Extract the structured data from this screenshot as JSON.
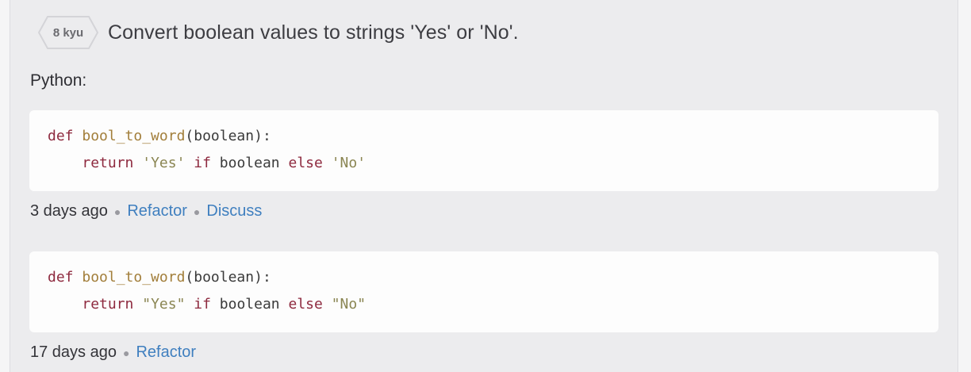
{
  "kata": {
    "rank": "8 kyu",
    "title": "Convert boolean values to strings 'Yes' or 'No'."
  },
  "language_label": "Python:",
  "solutions": [
    {
      "code": [
        {
          "tokens": [
            [
              "kw",
              "def"
            ],
            [
              "plain",
              " "
            ],
            [
              "fn",
              "bool_to_word"
            ],
            [
              "plain",
              "(boolean):"
            ]
          ]
        },
        {
          "tokens": [
            [
              "plain",
              "    "
            ],
            [
              "kw",
              "return"
            ],
            [
              "plain",
              " "
            ],
            [
              "str",
              "'Yes'"
            ],
            [
              "plain",
              " "
            ],
            [
              "kw",
              "if"
            ],
            [
              "plain",
              " boolean "
            ],
            [
              "kw",
              "else"
            ],
            [
              "plain",
              " "
            ],
            [
              "str",
              "'No'"
            ]
          ]
        }
      ],
      "age": "3 days ago",
      "actions": [
        "Refactor",
        "Discuss"
      ]
    },
    {
      "code": [
        {
          "tokens": [
            [
              "kw",
              "def"
            ],
            [
              "plain",
              " "
            ],
            [
              "fn",
              "bool_to_word"
            ],
            [
              "plain",
              "(boolean):"
            ]
          ]
        },
        {
          "tokens": [
            [
              "plain",
              "    "
            ],
            [
              "kw",
              "return"
            ],
            [
              "plain",
              " "
            ],
            [
              "str",
              "\"Yes\""
            ],
            [
              "plain",
              " "
            ],
            [
              "kw",
              "if"
            ],
            [
              "plain",
              " boolean "
            ],
            [
              "kw",
              "else"
            ],
            [
              "plain",
              " "
            ],
            [
              "str",
              "\"No\""
            ]
          ]
        }
      ],
      "age": "17 days ago",
      "actions": [
        "Refactor"
      ]
    }
  ],
  "icons": {
    "rank_badge": "hexagon-badge-icon",
    "separator": "bullet-dot"
  },
  "colors": {
    "link": "#3f7fbf",
    "keyword": "#8e2a3f",
    "function": "#a27e3a",
    "string": "#8a8552"
  }
}
